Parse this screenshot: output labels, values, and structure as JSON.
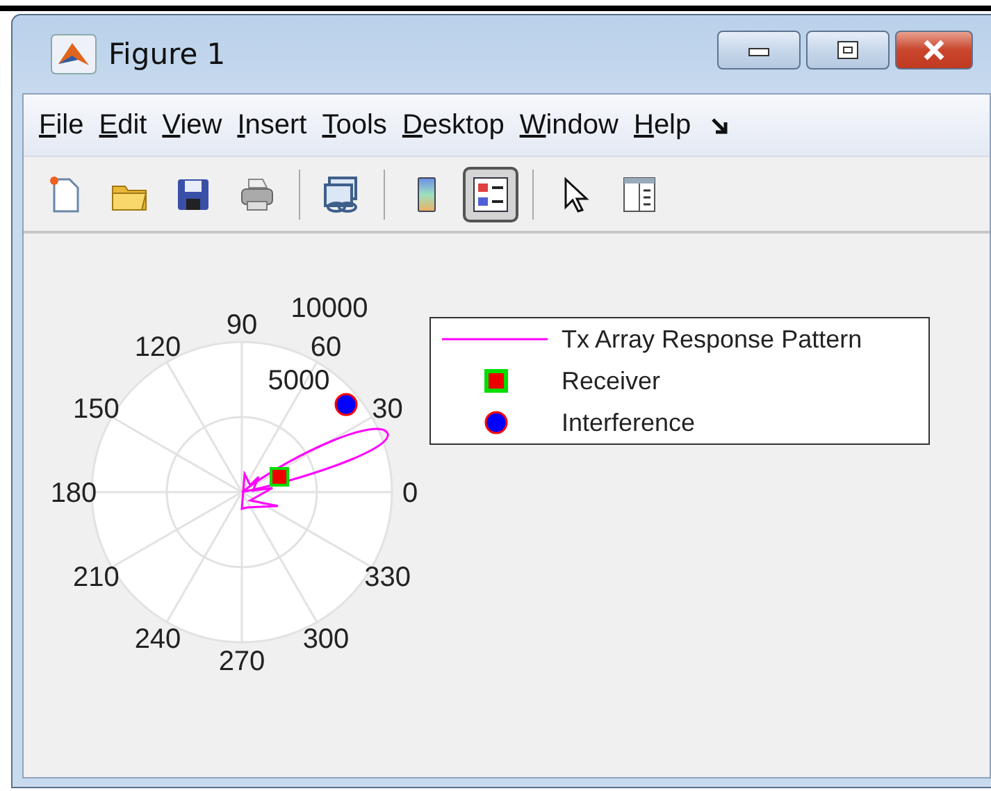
{
  "window": {
    "title": "Figure 1",
    "controls": [
      {
        "kind": "minimize"
      },
      {
        "kind": "restore"
      },
      {
        "kind": "close"
      }
    ]
  },
  "menu": [
    "File",
    "Edit",
    "View",
    "Insert",
    "Tools",
    "Desktop",
    "Window",
    "Help"
  ],
  "toolbar": [
    {
      "kind": "new",
      "pressed": false
    },
    {
      "kind": "open",
      "pressed": false
    },
    {
      "kind": "save",
      "pressed": false
    },
    {
      "kind": "print",
      "pressed": false
    },
    {
      "kind": "separator"
    },
    {
      "kind": "link",
      "pressed": false
    },
    {
      "kind": "separator"
    },
    {
      "kind": "colorbar",
      "pressed": false
    },
    {
      "kind": "legend",
      "pressed": true
    },
    {
      "kind": "separator"
    },
    {
      "kind": "pointer",
      "pressed": false
    },
    {
      "kind": "property",
      "pressed": false
    }
  ],
  "plot": {
    "angle_labels": [
      "0",
      "30",
      "60",
      "90",
      "120",
      "150",
      "180",
      "210",
      "240",
      "270",
      "300",
      "330"
    ],
    "radius_labels": [
      "5000",
      "10000"
    ],
    "legend": [
      {
        "kind": "line",
        "label": "Tx Array Response Pattern"
      },
      {
        "kind": "square",
        "label": "Receiver"
      },
      {
        "kind": "circle",
        "label": "Interference"
      }
    ]
  }
}
